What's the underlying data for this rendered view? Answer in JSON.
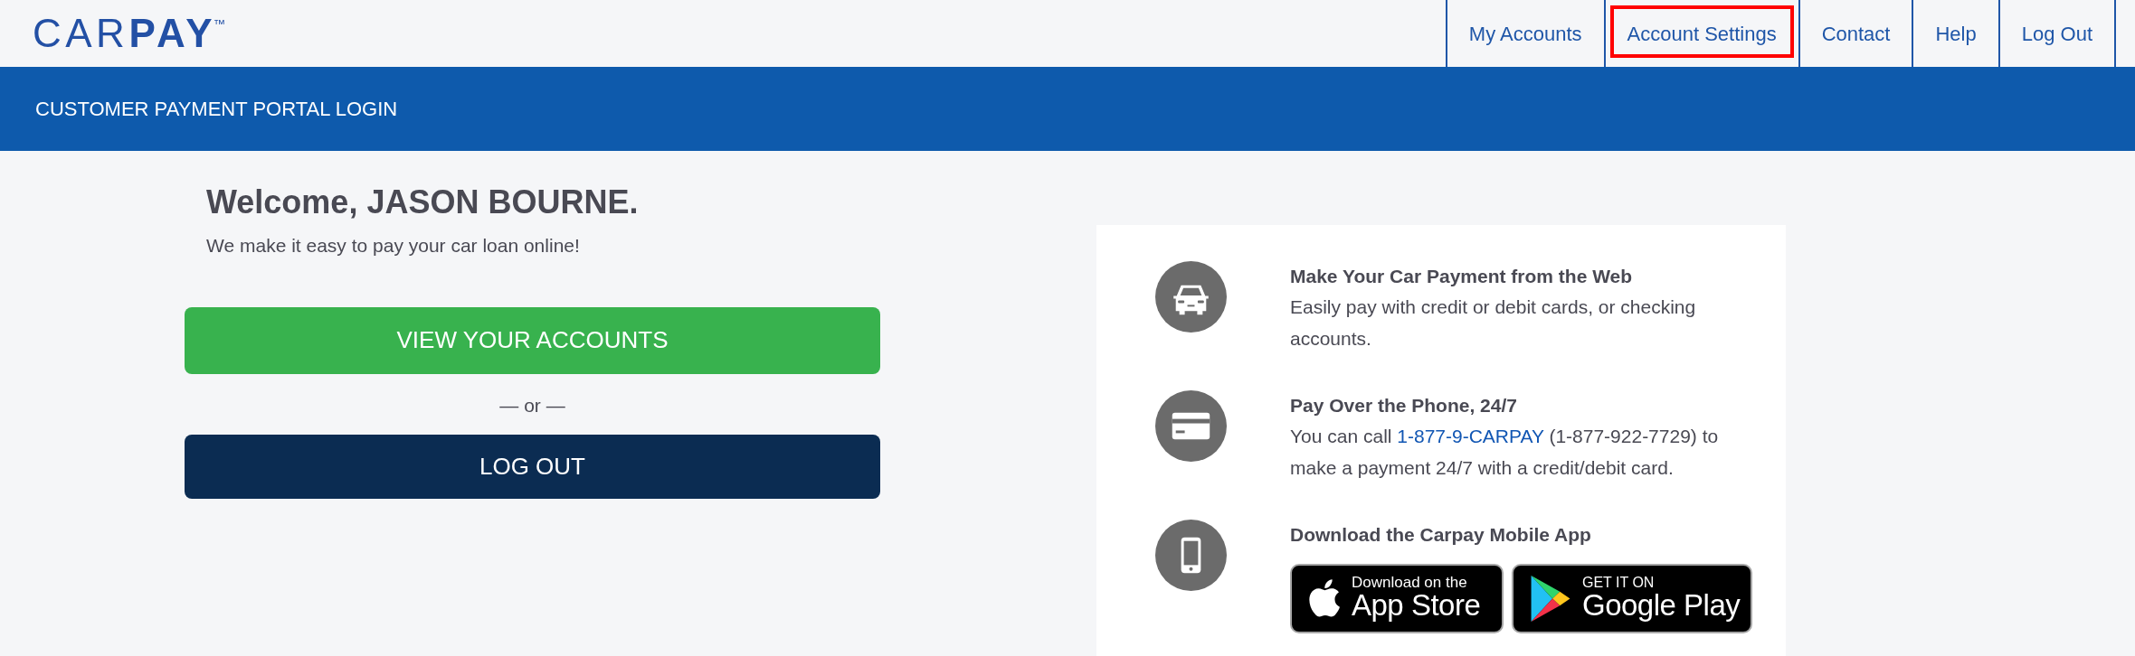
{
  "header": {
    "logo": "CAR**PAY**$^{™}$",
    "nav": [
      {
        "label": "My Accounts",
        "highlighted": false
      },
      {
        "label": "Account Settings",
        "highlighted": true
      },
      {
        "label": "Contact",
        "highlighted": false
      },
      {
        "label": "Help",
        "highlighted": false
      },
      {
        "label": "Log Out",
        "highlighted": false
      }
    ]
  },
  "banner": {
    "title": "CUSTOMER PAYMENT PORTAL LOGIN"
  },
  "welcome": {
    "heading": "Welcome, JASON BOURNE.",
    "subtitle": "We make it easy to pay your car loan online!",
    "actions": [
      {
        "kind": "primary",
        "label": "VIEW YOUR ACCOUNTS"
      },
      {
        "kind": "separator",
        "label": "— or —"
      },
      {
        "kind": "secondary",
        "label": "LOG OUT"
      }
    ]
  },
  "features": [
    {
      "kind": "text",
      "title": "Make Your Car Payment from the Web",
      "body": "Easily pay with credit or debit cards, or checking accounts."
    },
    {
      "kind": "text",
      "title": "Pay Over the Phone, 24/7",
      "body": "You can call ",
      "link": "1-877-9-CARPAY",
      "body_after": " (1-877-922-7729) to make a payment 24/7 with a credit/debit card."
    },
    {
      "kind": "apps",
      "title": "Download the Carpay Mobile App",
      "badges": [
        {
          "kind": "apple",
          "caption": "Download on the",
          "store": "App Store"
        },
        {
          "kind": "google",
          "caption": "GET IT ON",
          "store": "Google Play"
        }
      ]
    }
  ]
}
